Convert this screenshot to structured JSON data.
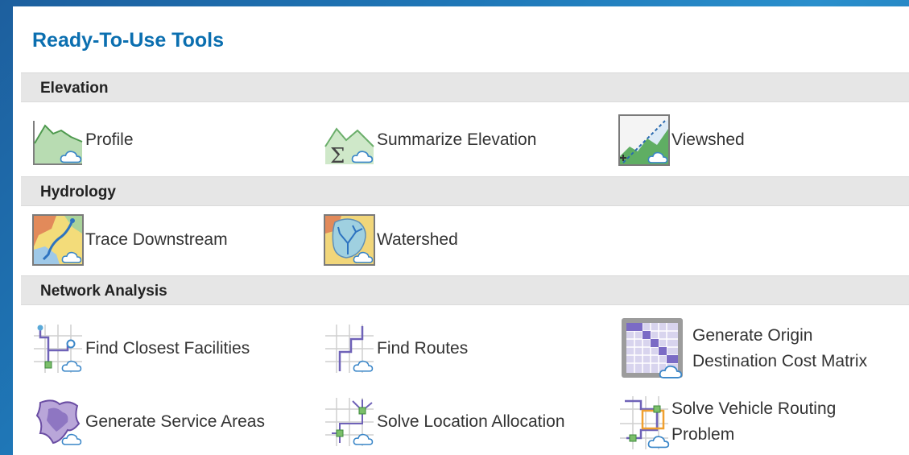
{
  "title": "Ready-To-Use Tools",
  "sections": [
    {
      "name": "Elevation",
      "tools": [
        {
          "label": "Profile",
          "icon": "profile-icon"
        },
        {
          "label": "Summarize Elevation",
          "icon": "summarize-elevation-icon"
        },
        {
          "label": "Viewshed",
          "icon": "viewshed-icon"
        }
      ]
    },
    {
      "name": "Hydrology",
      "tools": [
        {
          "label": "Trace Downstream",
          "icon": "trace-downstream-icon"
        },
        {
          "label": "Watershed",
          "icon": "watershed-icon"
        }
      ]
    },
    {
      "name": "Network Analysis",
      "tools": [
        {
          "label": "Find Closest Facilities",
          "icon": "find-closest-facilities-icon"
        },
        {
          "label": "Find Routes",
          "icon": "find-routes-icon"
        },
        {
          "label_line1": "Generate Origin",
          "label_line2": "Destination Cost Matrix",
          "icon": "cost-matrix-icon"
        },
        {
          "label": "Generate Service Areas",
          "icon": "service-areas-icon"
        },
        {
          "label": "Solve Location Allocation",
          "icon": "location-allocation-icon"
        },
        {
          "label_line1": "Solve Vehicle Routing",
          "label_line2": "Problem",
          "icon": "vehicle-routing-icon"
        }
      ]
    }
  ]
}
